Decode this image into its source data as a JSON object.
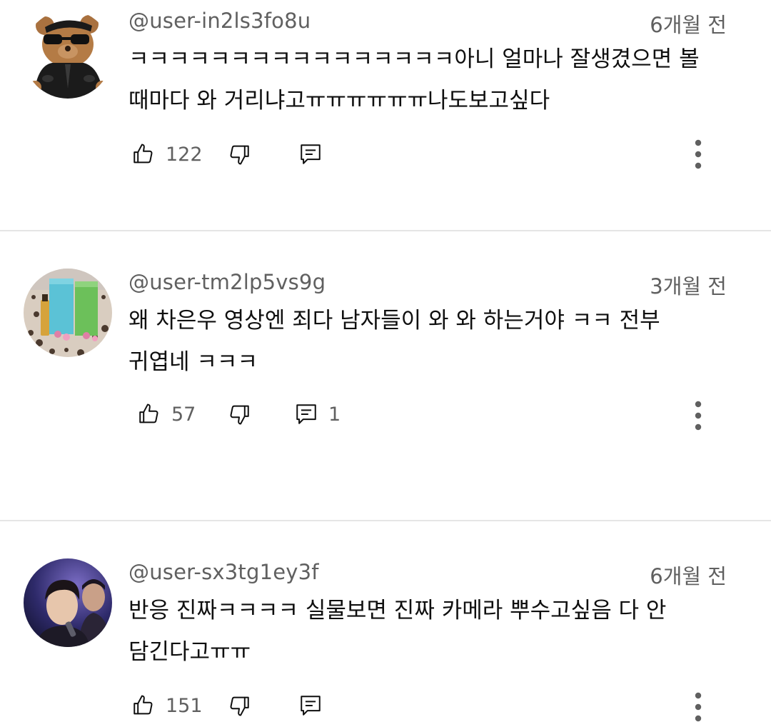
{
  "comments": [
    {
      "author": "@user-in2ls3fo8u",
      "time": "6개월 전",
      "text_line1": "ㅋㅋㅋㅋㅋㅋㅋㅋㅋㅋㅋㅋㅋㅋㅋㅋ아니 얼마나 잘생겼으면 볼",
      "text_line2": "때마다 와 거리냐고ㅠㅠㅠㅠㅠㅠ나도보고싶다",
      "likes": "122",
      "replies": ""
    },
    {
      "author": "@user-tm2lp5vs9g",
      "time": "3개월 전",
      "text_line1": "왜 차은우 영상엔 죄다 남자들이 와 와 하는거야 ㅋㅋ 전부",
      "text_line2": "귀엽네 ㅋㅋㅋ",
      "likes": "57",
      "replies": "1"
    },
    {
      "author": "@user-sx3tg1ey3f",
      "time": "6개월 전",
      "text_line1": "반응 진짜ㅋㅋㅋㅋ 실물보면 진짜 카메라 뿌수고싶음 다 안",
      "text_line2": "담긴다고ㅠㅠ",
      "likes": "151",
      "replies": ""
    }
  ],
  "icons": {
    "like": "thumb-up-icon",
    "dislike": "thumb-down-icon",
    "reply": "comment-icon",
    "more": "more-vert-icon"
  },
  "colors": {
    "meta_text": "#606060",
    "body_text": "#0f0f0f",
    "divider": "#e5e5e5"
  }
}
